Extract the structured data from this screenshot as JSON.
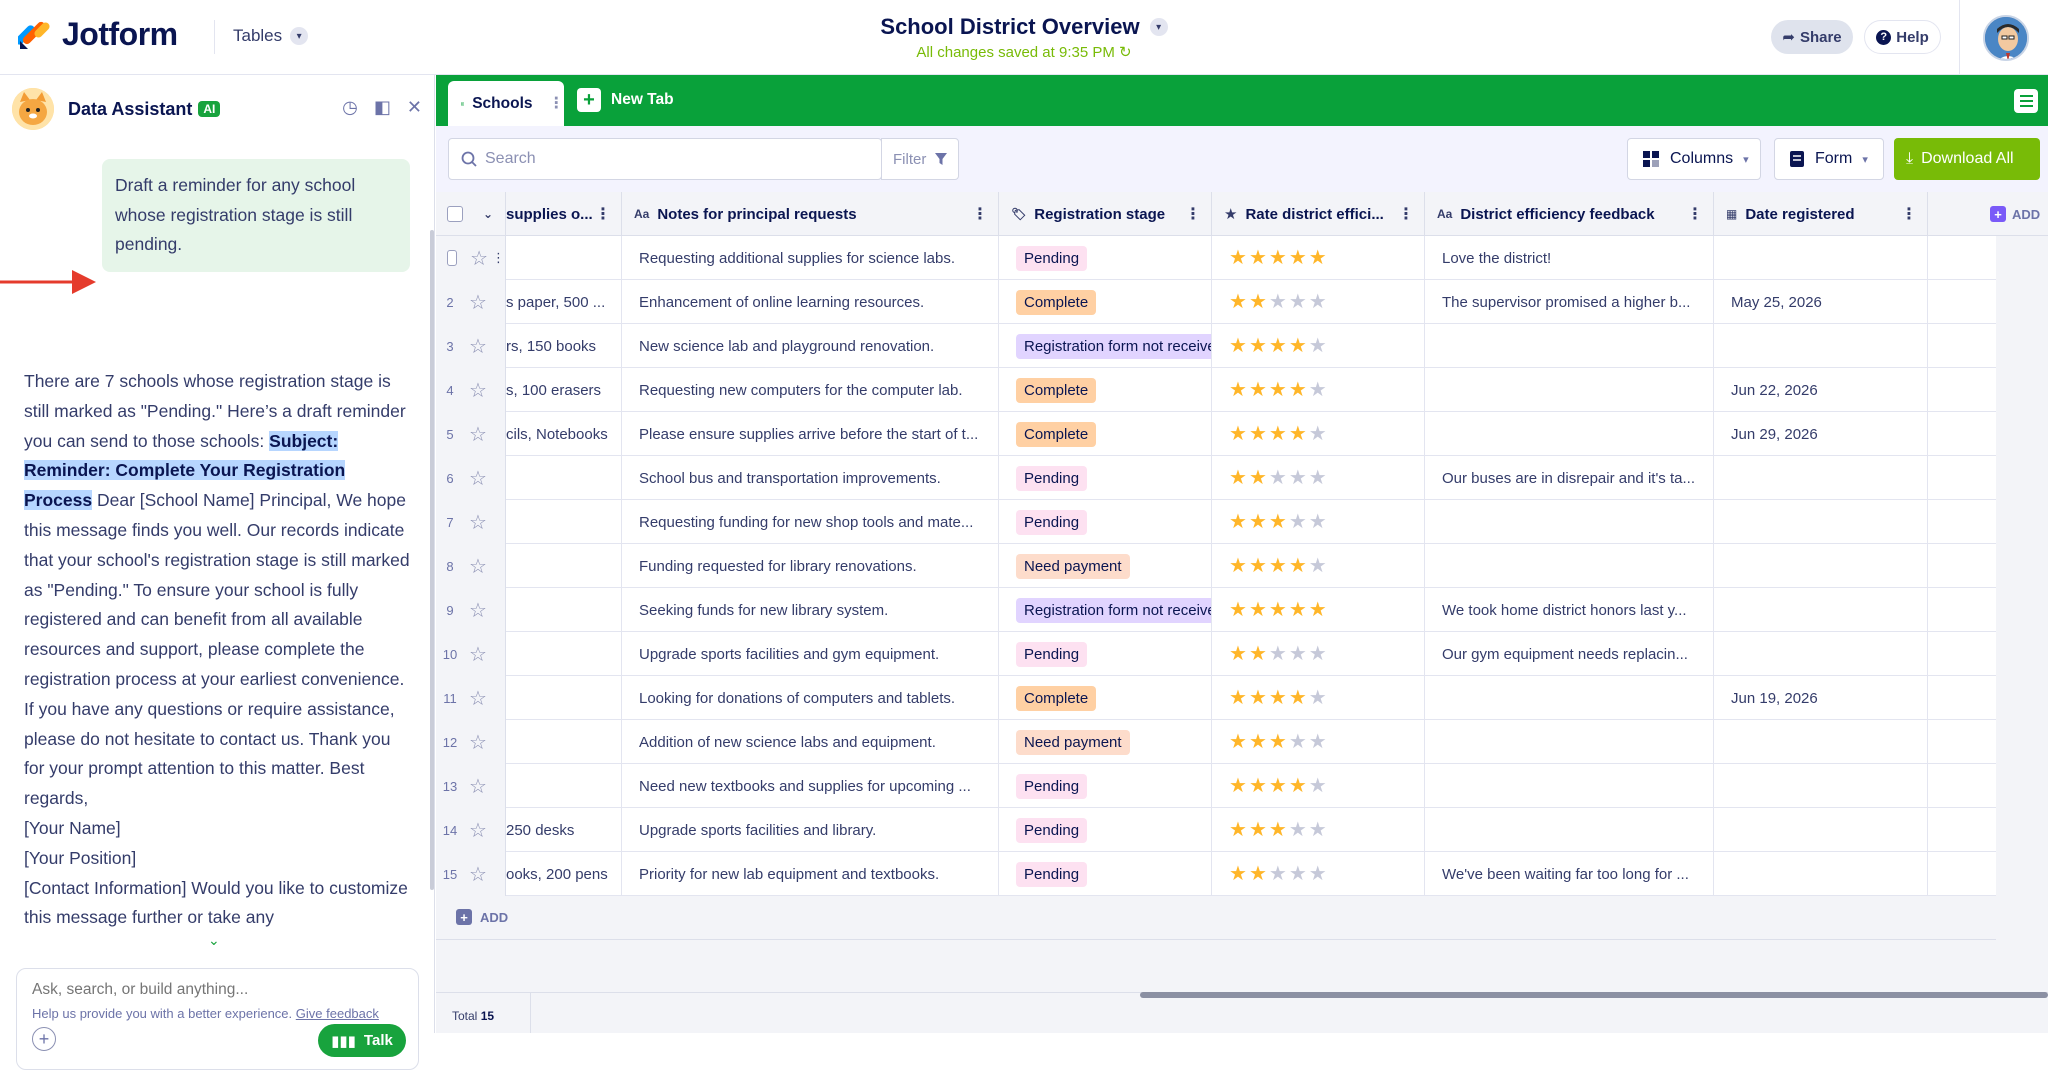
{
  "app": {
    "logo_text": "Jotform",
    "tables_menu": "Tables",
    "doc_title": "School District Overview",
    "saved_status": "All changes saved at 9:35 PM",
    "share_label": "Share",
    "help_label": "Help"
  },
  "assistant": {
    "title": "Data Assistant",
    "ai_badge": "AI",
    "user_message": "Draft a reminder for any school whose registration stage is still pending.",
    "answer_intro": "There are 7 schools whose registration stage is still marked as \"Pending.\" Here’s a draft reminder you can send to those schools: ",
    "answer_subject": "Subject: Reminder: Complete Your Registration Process",
    "answer_body": " Dear [School Name] Principal, We hope this message finds you well. Our records indicate that your school's registration stage is still marked as \"Pending.\" To ensure your school is fully registered and can benefit from all available resources and support, please complete the registration process at your earliest convenience. If you have any questions or require assistance, please do not hesitate to contact us. Thank you for your prompt attention to this matter. Best regards,",
    "answer_name": "[Your Name]",
    "answer_position": "[Your Position]",
    "answer_contact": "[Contact Information] Would you like to customize this message further or take any",
    "input_placeholder": "Ask, search, or build anything...",
    "talk_label": "Talk",
    "feedback_text": "Help us provide you with a better experience.",
    "feedback_link": "Give feedback"
  },
  "tabs": {
    "active": "Schools",
    "new_tab": "New Tab"
  },
  "toolbar": {
    "search_placeholder": "Search",
    "filter_label": "Filter",
    "columns_label": "Columns",
    "form_label": "Form",
    "download_label": "Download All"
  },
  "columns": {
    "supplies": "supplies o...",
    "notes": "Notes for principal requests",
    "stage": "Registration stage",
    "rate": "Rate district effici...",
    "feedback": "District efficiency feedback",
    "date": "Date registered",
    "add": "ADD"
  },
  "rows": [
    {
      "n": "",
      "supplies": "",
      "notes": "Requesting additional supplies for science labs.",
      "stage": "Pending",
      "stage_type": "pending",
      "rating": 5,
      "feedback": "Love the district!",
      "date": ""
    },
    {
      "n": "2",
      "supplies": "s paper, 500 ...",
      "notes": "Enhancement of online learning resources.",
      "stage": "Complete",
      "stage_type": "complete",
      "rating": 2,
      "feedback": "The supervisor promised a higher b...",
      "date": "May 25, 2026"
    },
    {
      "n": "3",
      "supplies": "rs, 150 books",
      "notes": "New science lab and playground renovation.",
      "stage": "Registration form not received",
      "stage_type": "regform",
      "rating": 4,
      "feedback": "",
      "date": ""
    },
    {
      "n": "4",
      "supplies": "s, 100 erasers",
      "notes": "Requesting new computers for the computer lab.",
      "stage": "Complete",
      "stage_type": "complete",
      "rating": 4,
      "feedback": "",
      "date": "Jun 22, 2026"
    },
    {
      "n": "5",
      "supplies": "cils, Notebooks",
      "notes": "Please ensure supplies arrive before the start of t...",
      "stage": "Complete",
      "stage_type": "complete",
      "rating": 4,
      "feedback": "",
      "date": "Jun 29, 2026"
    },
    {
      "n": "6",
      "supplies": "",
      "notes": "School bus and transportation improvements.",
      "stage": "Pending",
      "stage_type": "pending",
      "rating": 2,
      "feedback": "Our buses are in disrepair and it's ta...",
      "date": ""
    },
    {
      "n": "7",
      "supplies": "",
      "notes": "Requesting funding for new shop tools and mate...",
      "stage": "Pending",
      "stage_type": "pending",
      "rating": 3,
      "feedback": "",
      "date": ""
    },
    {
      "n": "8",
      "supplies": "",
      "notes": "Funding requested for library renovations.",
      "stage": "Need payment",
      "stage_type": "needpay",
      "rating": 4,
      "feedback": "",
      "date": ""
    },
    {
      "n": "9",
      "supplies": "",
      "notes": "Seeking funds for new library system.",
      "stage": "Registration form not received",
      "stage_type": "regform",
      "rating": 5,
      "feedback": "We took home district honors last y...",
      "date": ""
    },
    {
      "n": "10",
      "supplies": "",
      "notes": "Upgrade sports facilities and gym equipment.",
      "stage": "Pending",
      "stage_type": "pending",
      "rating": 2,
      "feedback": "Our gym equipment needs replacin...",
      "date": ""
    },
    {
      "n": "11",
      "supplies": "",
      "notes": "Looking for donations of computers and tablets.",
      "stage": "Complete",
      "stage_type": "complete",
      "rating": 4,
      "feedback": "",
      "date": "Jun 19, 2026"
    },
    {
      "n": "12",
      "supplies": "",
      "notes": "Addition of new science labs and equipment.",
      "stage": "Need payment",
      "stage_type": "needpay",
      "rating": 3,
      "feedback": "",
      "date": ""
    },
    {
      "n": "13",
      "supplies": "",
      "notes": "Need new textbooks and supplies for upcoming ...",
      "stage": "Pending",
      "stage_type": "pending",
      "rating": 4,
      "feedback": "",
      "date": ""
    },
    {
      "n": "14",
      "supplies": " 250 desks",
      "notes": "Upgrade sports facilities and library.",
      "stage": "Pending",
      "stage_type": "pending",
      "rating": 3,
      "feedback": "",
      "date": ""
    },
    {
      "n": "15",
      "supplies": "ooks, 200 pens",
      "notes": "Priority for new lab equipment and textbooks.",
      "stage": "Pending",
      "stage_type": "pending",
      "rating": 2,
      "feedback": "We've been waiting far too long for ...",
      "date": ""
    }
  ],
  "add_row_label": "ADD",
  "footer": {
    "total_label": "Total",
    "total_value": "15"
  },
  "colors": {
    "brand_green": "#09a13a",
    "download_green": "#78bb07",
    "navy": "#0a1551"
  }
}
